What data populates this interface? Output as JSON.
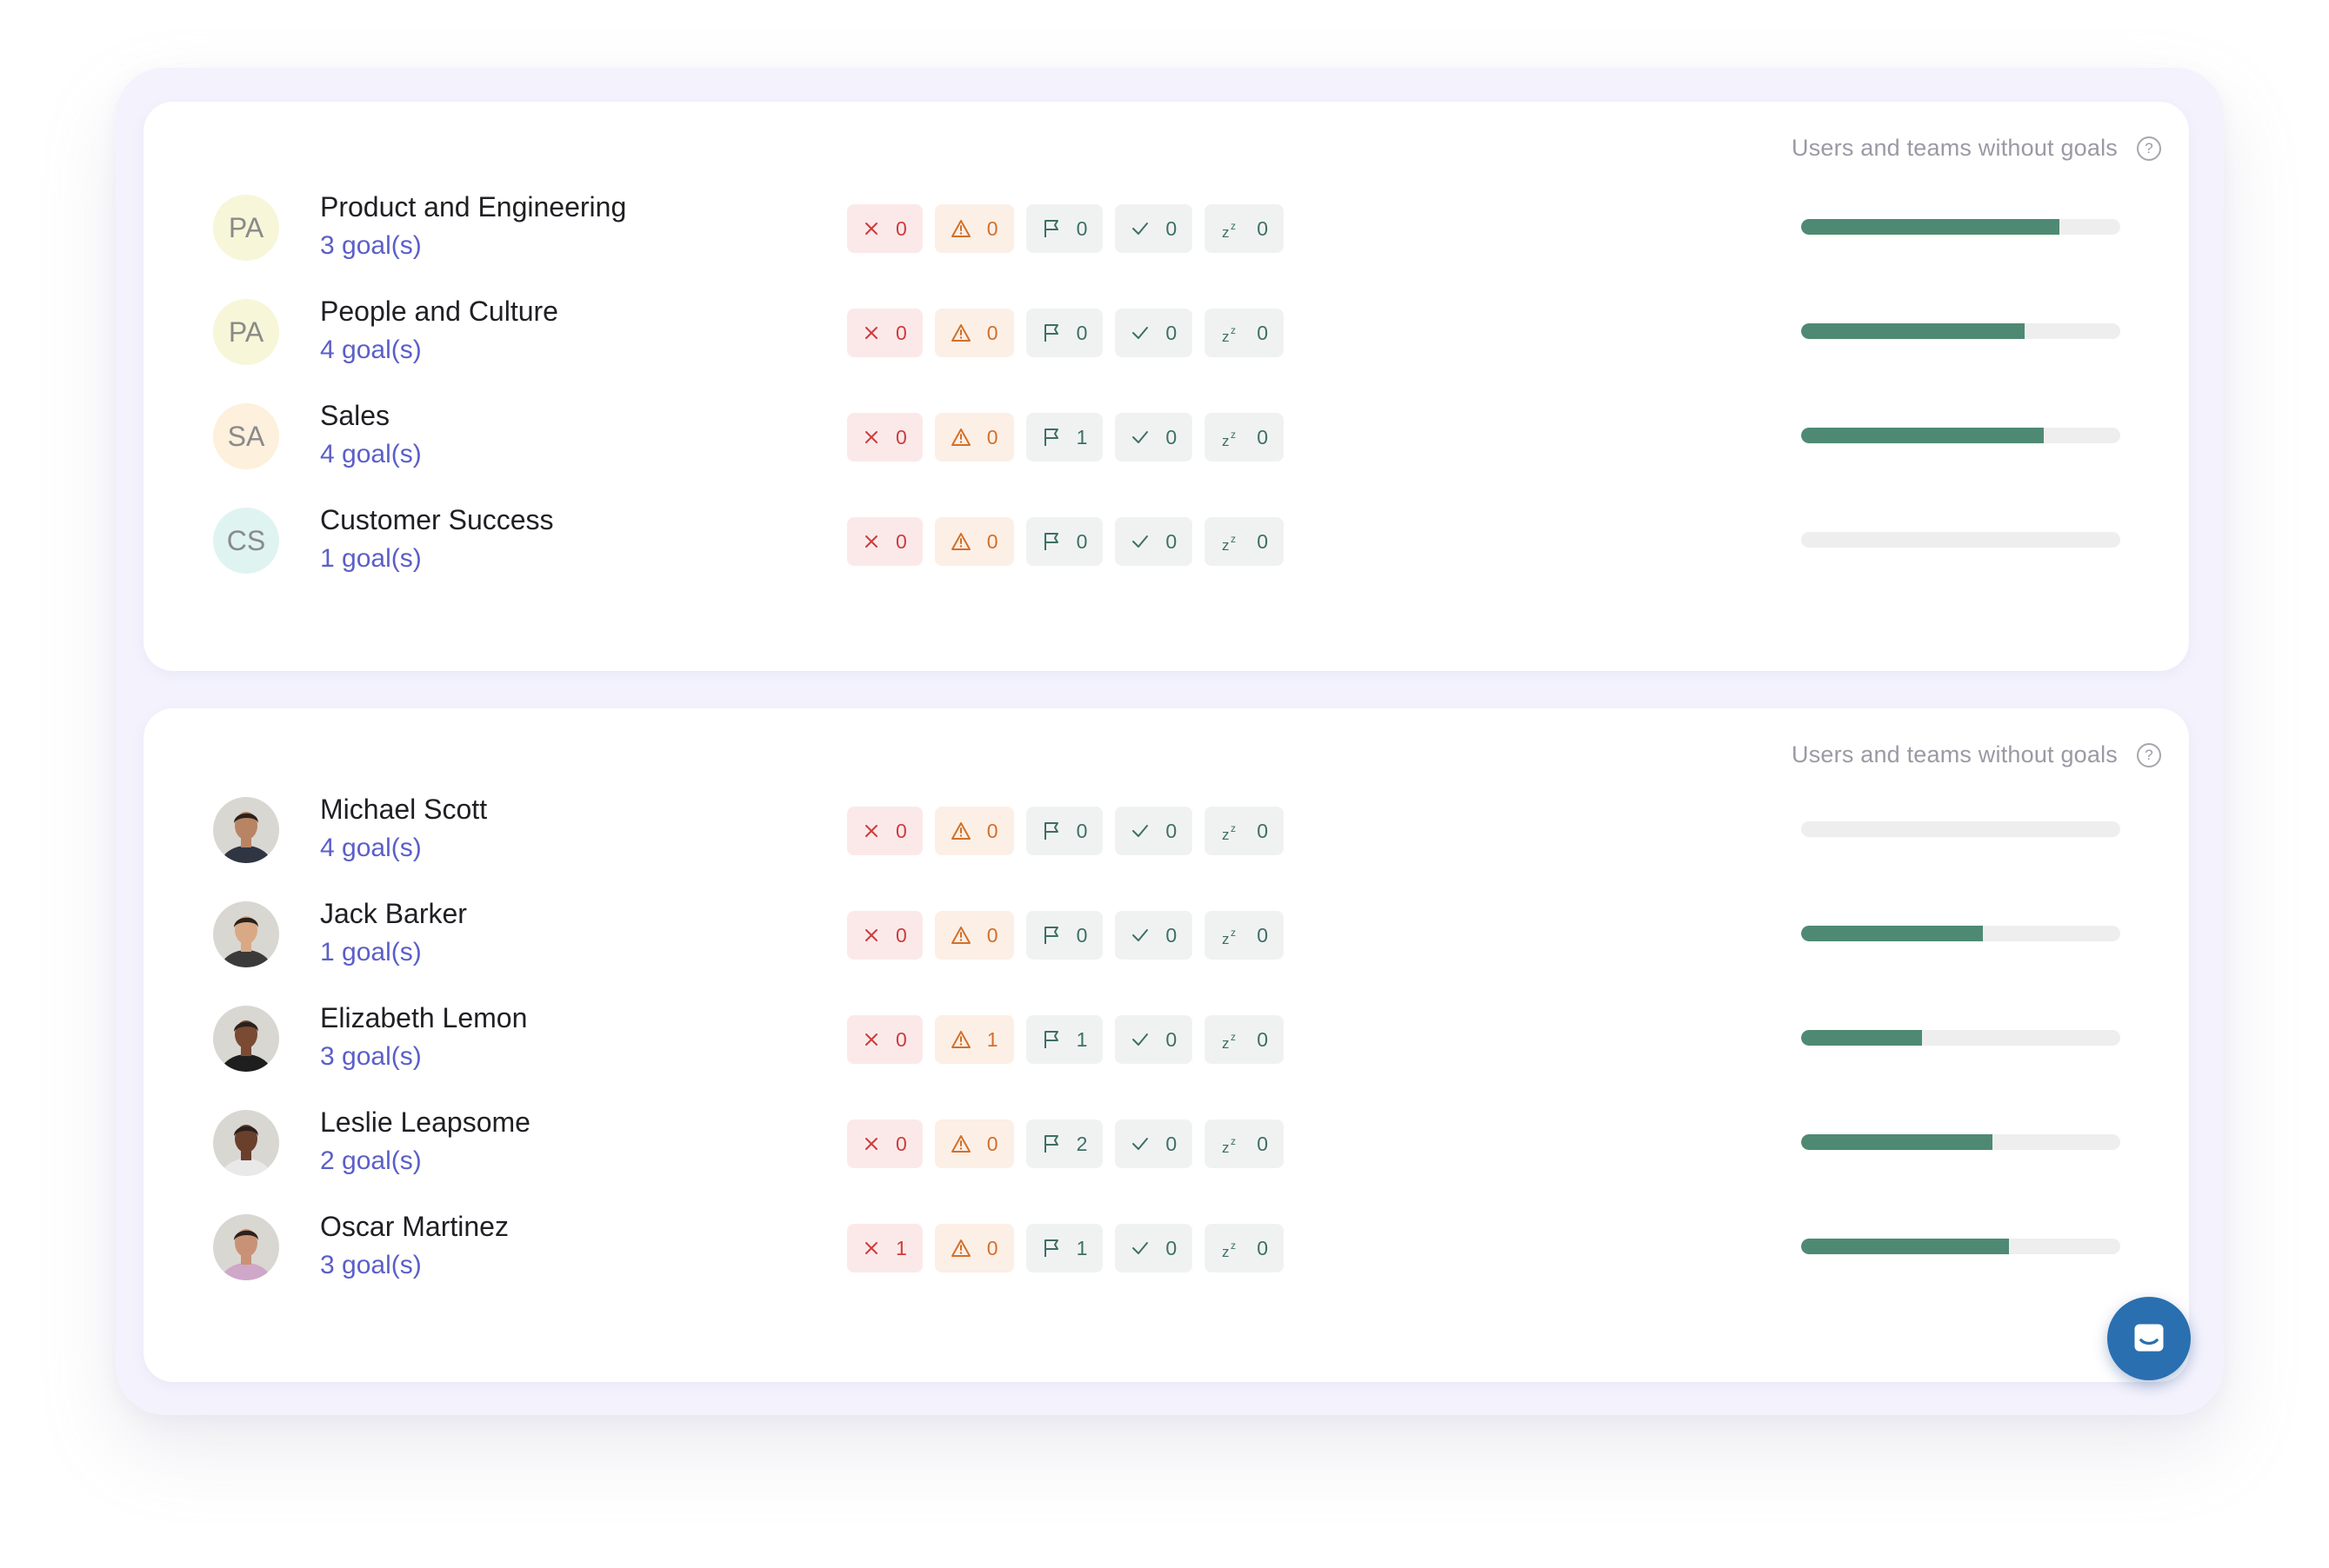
{
  "colors": {
    "accent_link": "#5b5fc7",
    "progress": "#4e8a73",
    "chat_button": "#2a6fb0"
  },
  "teams_card": {
    "header": "Users and teams without goals",
    "rows": [
      {
        "name": "Product and Engineering",
        "initials": "PA",
        "avatar_color": "#f7f6d8",
        "goals": "3 goal(s)",
        "counts": {
          "off_track": "0",
          "at_risk": "0",
          "flag": "0",
          "done": "0",
          "paused": "0"
        },
        "progress": 0.81
      },
      {
        "name": "People and Culture",
        "initials": "PA",
        "avatar_color": "#f7f6d8",
        "goals": "4 goal(s)",
        "counts": {
          "off_track": "0",
          "at_risk": "0",
          "flag": "0",
          "done": "0",
          "paused": "0"
        },
        "progress": 0.7
      },
      {
        "name": "Sales",
        "initials": "SA",
        "avatar_color": "#fdf0dc",
        "goals": "4 goal(s)",
        "counts": {
          "off_track": "0",
          "at_risk": "0",
          "flag": "1",
          "done": "0",
          "paused": "0"
        },
        "progress": 0.76
      },
      {
        "name": "Customer Success",
        "initials": "CS",
        "avatar_color": "#dff4f1",
        "goals": "1 goal(s)",
        "counts": {
          "off_track": "0",
          "at_risk": "0",
          "flag": "0",
          "done": "0",
          "paused": "0"
        },
        "progress": 0
      }
    ]
  },
  "users_card": {
    "header": "Users and teams without goals",
    "rows": [
      {
        "name": "Michael Scott",
        "avatar_icon": "user-photo-icon",
        "goals": "4 goal(s)",
        "counts": {
          "off_track": "0",
          "at_risk": "0",
          "flag": "0",
          "done": "0",
          "paused": "0"
        },
        "progress": 0
      },
      {
        "name": "Jack Barker",
        "avatar_icon": "user-photo-icon",
        "goals": "1 goal(s)",
        "counts": {
          "off_track": "0",
          "at_risk": "0",
          "flag": "0",
          "done": "0",
          "paused": "0"
        },
        "progress": 0.57
      },
      {
        "name": "Elizabeth Lemon",
        "avatar_icon": "user-photo-icon",
        "goals": "3 goal(s)",
        "counts": {
          "off_track": "0",
          "at_risk": "1",
          "flag": "1",
          "done": "0",
          "paused": "0"
        },
        "progress": 0.38
      },
      {
        "name": "Leslie Leapsome",
        "avatar_icon": "user-photo-icon",
        "goals": "2 goal(s)",
        "counts": {
          "off_track": "0",
          "at_risk": "0",
          "flag": "2",
          "done": "0",
          "paused": "0"
        },
        "progress": 0.6
      },
      {
        "name": "Oscar Martinez",
        "avatar_icon": "user-photo-icon",
        "goals": "3 goal(s)",
        "counts": {
          "off_track": "1",
          "at_risk": "0",
          "flag": "1",
          "done": "0",
          "paused": "0"
        },
        "progress": 0.65
      }
    ]
  },
  "icons": {
    "help": "question-circle-icon",
    "off_track": "x-icon",
    "at_risk": "warning-triangle-icon",
    "flag": "flag-icon",
    "done": "checkmark-icon",
    "paused": "sleep-zz-icon",
    "chat": "chat-bubble-icon"
  }
}
